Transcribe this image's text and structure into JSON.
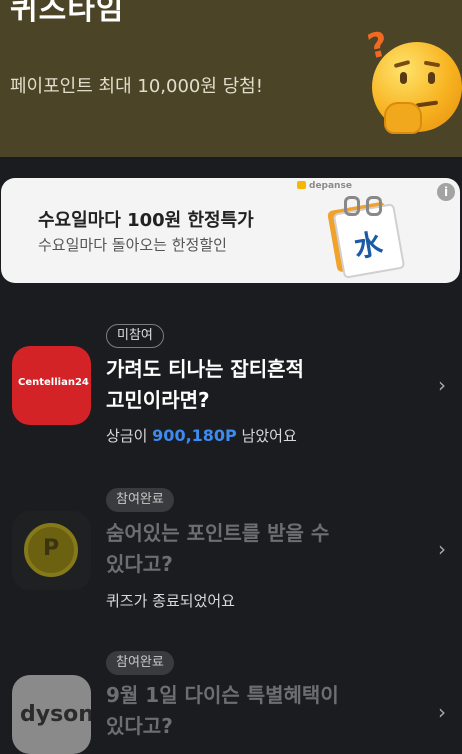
{
  "banner": {
    "title": "퀴즈타임",
    "subtitle": "페이포인트 최대 10,000원 당첨!"
  },
  "ad": {
    "title": "수요일마다 100원 한정특가",
    "subtitle": "수요일마다 돌아오는 한정할인",
    "brand": "depanse",
    "info_icon": "i",
    "calendar_text": "水"
  },
  "quizzes": [
    {
      "logo_text": "Centellian24",
      "status": "미참여",
      "title_line1": "가려도 티나는 잡티흔적",
      "title_line2": "고민이라면?",
      "info_prefix": "상금이 ",
      "info_amount": "900,180P",
      "info_suffix": " 남았어요"
    },
    {
      "logo_text": "P",
      "status": "참여완료",
      "title_line1": "숨어있는 포인트를 받을 수",
      "title_line2": "있다고?",
      "info": "퀴즈가 종료되었어요"
    },
    {
      "logo_text": "dyson",
      "status": "참여완료",
      "title_line1": "9월 1일 다이슨 특별혜택이",
      "title_line2": "있다고?"
    }
  ],
  "colors": {
    "banner_bg": "#4b4427",
    "page_bg": "#1b1c1f",
    "accent_blue": "#3d8af0"
  }
}
